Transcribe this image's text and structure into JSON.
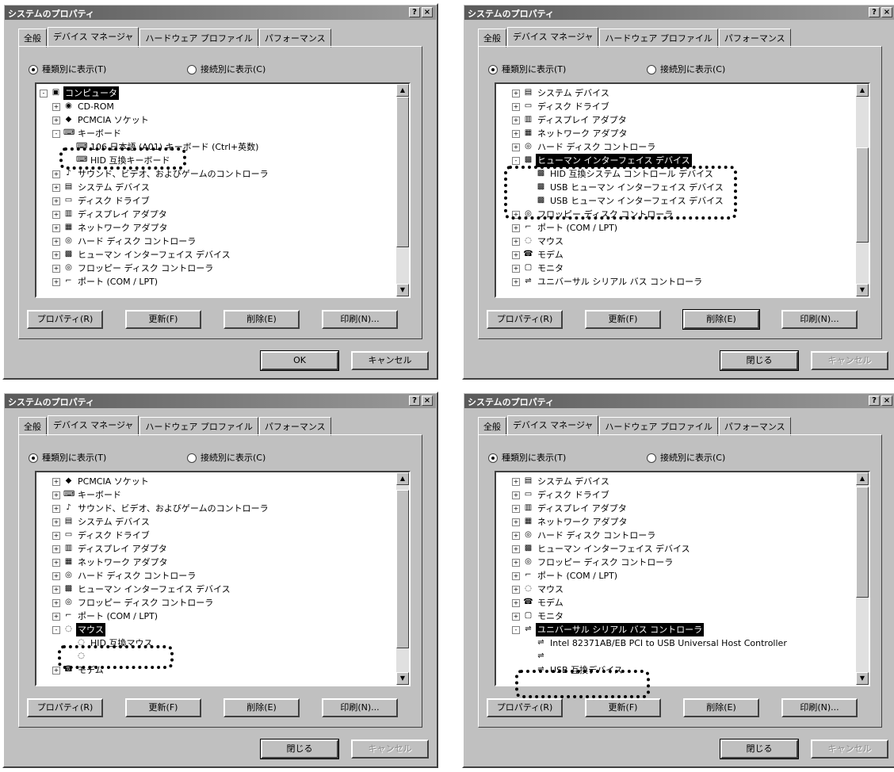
{
  "screenshot_title": "システムのプロパティ",
  "tabs": [
    "全般",
    "デバイス マネージャ",
    "ハードウェア プロファイル",
    "パフォーマンス"
  ],
  "radios": {
    "by_type": "種類別に表示(T)",
    "by_connection": "接続別に表示(C)"
  },
  "buttons": {
    "properties": "プロパティ(R)",
    "refresh": "更新(F)",
    "remove": "削除(E)",
    "print": "印刷(N)...",
    "ok": "OK",
    "cancel": "キャンセル",
    "close": "閉じる"
  },
  "dialogs": [
    {
      "rows": [
        {
          "level": 0,
          "exp": "-",
          "icon": "computer-icon",
          "label": "コンピュータ",
          "sel": true
        },
        {
          "level": 1,
          "exp": "+",
          "icon": "cdrom-icon",
          "label": "CD-ROM"
        },
        {
          "level": 1,
          "exp": "+",
          "icon": "pcmcia-icon",
          "label": "PCMCIA ソケット"
        },
        {
          "level": 1,
          "exp": "-",
          "icon": "keyboard-icon",
          "label": "キーボード"
        },
        {
          "level": 2,
          "icon": "keyboard-icon",
          "label": "106 日本語 (A01) キーボード (Ctrl+英数)"
        },
        {
          "level": 2,
          "icon": "keyboard-icon",
          "label": "HID 互換キーボード"
        },
        {
          "level": 1,
          "exp": "+",
          "icon": "sound-icon",
          "label": "サウンド、ビデオ、およびゲームのコントローラ"
        },
        {
          "level": 1,
          "exp": "+",
          "icon": "system-icon",
          "label": "システム デバイス"
        },
        {
          "level": 1,
          "exp": "+",
          "icon": "disk-icon",
          "label": "ディスク ドライブ"
        },
        {
          "level": 1,
          "exp": "+",
          "icon": "display-icon",
          "label": "ディスプレイ アダプタ"
        },
        {
          "level": 1,
          "exp": "+",
          "icon": "network-icon",
          "label": "ネットワーク アダプタ"
        },
        {
          "level": 1,
          "exp": "+",
          "icon": "hdd-controller-icon",
          "label": "ハード ディスク コントローラ"
        },
        {
          "level": 1,
          "exp": "+",
          "icon": "hid-icon",
          "label": "ヒューマン インターフェイス デバイス"
        },
        {
          "level": 1,
          "exp": "+",
          "icon": "floppy-icon",
          "label": "フロッピー ディスク コントローラ"
        },
        {
          "level": 1,
          "exp": "+",
          "icon": "port-icon",
          "label": "ポート (COM / LPT)"
        }
      ]
    },
    {
      "rows": [
        {
          "level": 1,
          "exp": "+",
          "icon": "system-icon",
          "label": "システム デバイス"
        },
        {
          "level": 1,
          "exp": "+",
          "icon": "disk-icon",
          "label": "ディスク ドライブ"
        },
        {
          "level": 1,
          "exp": "+",
          "icon": "display-icon",
          "label": "ディスプレイ アダプタ"
        },
        {
          "level": 1,
          "exp": "+",
          "icon": "network-icon",
          "label": "ネットワーク アダプタ"
        },
        {
          "level": 1,
          "exp": "+",
          "icon": "hdd-controller-icon",
          "label": "ハード ディスク コントローラ"
        },
        {
          "level": 1,
          "exp": "-",
          "icon": "hid-icon",
          "label": "ヒューマン インターフェイス デバイス",
          "sel": true
        },
        {
          "level": 2,
          "icon": "hid-icon",
          "label": "HID 互換システム コントロール デバイス"
        },
        {
          "level": 2,
          "icon": "hid-icon",
          "label": "USB ヒューマン インターフェイス デバイス"
        },
        {
          "level": 2,
          "icon": "hid-icon",
          "label": "USB ヒューマン インターフェイス デバイス"
        },
        {
          "level": 1,
          "exp": "+",
          "icon": "floppy-icon",
          "label": "フロッピー ディスク コントローラ"
        },
        {
          "level": 1,
          "exp": "+",
          "icon": "port-icon",
          "label": "ポート (COM / LPT)"
        },
        {
          "level": 1,
          "exp": "+",
          "icon": "mouse-icon",
          "label": "マウス"
        },
        {
          "level": 1,
          "exp": "+",
          "icon": "modem-icon",
          "label": "モデム"
        },
        {
          "level": 1,
          "exp": "+",
          "icon": "monitor-icon",
          "label": "モニタ"
        },
        {
          "level": 1,
          "exp": "+",
          "icon": "usb-icon",
          "label": "ユニバーサル シリアル バス コントローラ"
        }
      ]
    },
    {
      "rows": [
        {
          "level": 1,
          "exp": "+",
          "icon": "pcmcia-icon",
          "label": "PCMCIA ソケット"
        },
        {
          "level": 1,
          "exp": "+",
          "icon": "keyboard-icon",
          "label": "キーボード"
        },
        {
          "level": 1,
          "exp": "+",
          "icon": "sound-icon",
          "label": "サウンド、ビデオ、およびゲームのコントローラ"
        },
        {
          "level": 1,
          "exp": "+",
          "icon": "system-icon",
          "label": "システム デバイス"
        },
        {
          "level": 1,
          "exp": "+",
          "icon": "disk-icon",
          "label": "ディスク ドライブ"
        },
        {
          "level": 1,
          "exp": "+",
          "icon": "display-icon",
          "label": "ディスプレイ アダプタ"
        },
        {
          "level": 1,
          "exp": "+",
          "icon": "network-icon",
          "label": "ネットワーク アダプタ"
        },
        {
          "level": 1,
          "exp": "+",
          "icon": "hdd-controller-icon",
          "label": "ハード ディスク コントローラ"
        },
        {
          "level": 1,
          "exp": "+",
          "icon": "hid-icon",
          "label": "ヒューマン インターフェイス デバイス"
        },
        {
          "level": 1,
          "exp": "+",
          "icon": "floppy-icon",
          "label": "フロッピー ディスク コントローラ"
        },
        {
          "level": 1,
          "exp": "+",
          "icon": "port-icon",
          "label": "ポート (COM / LPT)"
        },
        {
          "level": 1,
          "exp": "-",
          "icon": "mouse-icon",
          "label": "マウス",
          "sel": true
        },
        {
          "level": 2,
          "icon": "mouse-icon",
          "label": "HID 互換マウス"
        },
        {
          "level": 2,
          "icon": "mouse-icon",
          "label": ""
        },
        {
          "level": 1,
          "exp": "+",
          "icon": "modem-icon",
          "label": "モデム"
        }
      ]
    },
    {
      "rows": [
        {
          "level": 1,
          "exp": "+",
          "icon": "system-icon",
          "label": "システム デバイス"
        },
        {
          "level": 1,
          "exp": "+",
          "icon": "disk-icon",
          "label": "ディスク ドライブ"
        },
        {
          "level": 1,
          "exp": "+",
          "icon": "display-icon",
          "label": "ディスプレイ アダプタ"
        },
        {
          "level": 1,
          "exp": "+",
          "icon": "network-icon",
          "label": "ネットワーク アダプタ"
        },
        {
          "level": 1,
          "exp": "+",
          "icon": "hdd-controller-icon",
          "label": "ハード ディスク コントローラ"
        },
        {
          "level": 1,
          "exp": "+",
          "icon": "hid-icon",
          "label": "ヒューマン インターフェイス デバイス"
        },
        {
          "level": 1,
          "exp": "+",
          "icon": "floppy-icon",
          "label": "フロッピー ディスク コントローラ"
        },
        {
          "level": 1,
          "exp": "+",
          "icon": "port-icon",
          "label": "ポート (COM / LPT)"
        },
        {
          "level": 1,
          "exp": "+",
          "icon": "mouse-icon",
          "label": "マウス"
        },
        {
          "level": 1,
          "exp": "+",
          "icon": "modem-icon",
          "label": "モデム"
        },
        {
          "level": 1,
          "exp": "+",
          "icon": "monitor-icon",
          "label": "モニタ"
        },
        {
          "level": 1,
          "exp": "-",
          "icon": "usb-icon",
          "label": "ユニバーサル シリアル バス コントローラ",
          "sel": true
        },
        {
          "level": 2,
          "icon": "usb-icon",
          "label": "Intel 82371AB/EB PCI to USB Universal Host Controller"
        },
        {
          "level": 2,
          "icon": "usb-icon",
          "label": ""
        },
        {
          "level": 2,
          "icon": "usb-icon",
          "label": "USB 互換デバイス"
        }
      ]
    }
  ]
}
